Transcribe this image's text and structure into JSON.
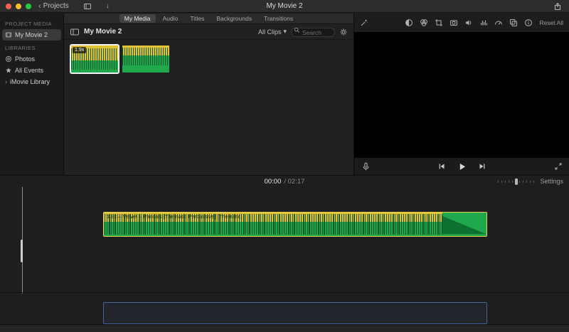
{
  "titlebar": {
    "back_label": "Projects",
    "title": "My Movie 2"
  },
  "icons": {
    "back_chevron": "‹",
    "disclosure": "›",
    "dropdown": "▾",
    "download_arrow": "↓"
  },
  "sidebar": {
    "project_media_heading": "PROJECT MEDIA",
    "project_items": [
      {
        "label": "My Movie 2",
        "selected": true
      }
    ],
    "libraries_heading": "LIBRARIES",
    "library_items": [
      {
        "label": "Photos"
      },
      {
        "label": "All Events"
      },
      {
        "label": "iMovie Library"
      }
    ]
  },
  "media_panel": {
    "tabs": [
      {
        "label": "My Media",
        "active": true
      },
      {
        "label": "Audio",
        "active": false
      },
      {
        "label": "Titles",
        "active": false
      },
      {
        "label": "Backgrounds",
        "active": false
      },
      {
        "label": "Transitions",
        "active": false
      }
    ],
    "browser_title": "My Movie 2",
    "filter_label": "All Clips",
    "search_placeholder": "Search",
    "clips": [
      {
        "badge": "1.9x",
        "selected": true,
        "type": "audio-waveform"
      },
      {
        "badge": "",
        "selected": false,
        "type": "audio-waveform"
      }
    ]
  },
  "viewer": {
    "reset_all_label": "Reset All"
  },
  "timeline": {
    "current_time": "00:00",
    "total_time": "/ 02:17",
    "settings_label": "Settings",
    "audio_clip_label": "1.9x – Velvet – Pascals [Thematic Percussive] [Thematic]"
  },
  "colors": {
    "clip_green": "#1fa94c",
    "clip_waveform_dark_green": "#0d6f30",
    "clip_yellow": "#e3c336",
    "selection_border_yellow": "#e6d44a",
    "music_well_blue": "#47639c"
  }
}
